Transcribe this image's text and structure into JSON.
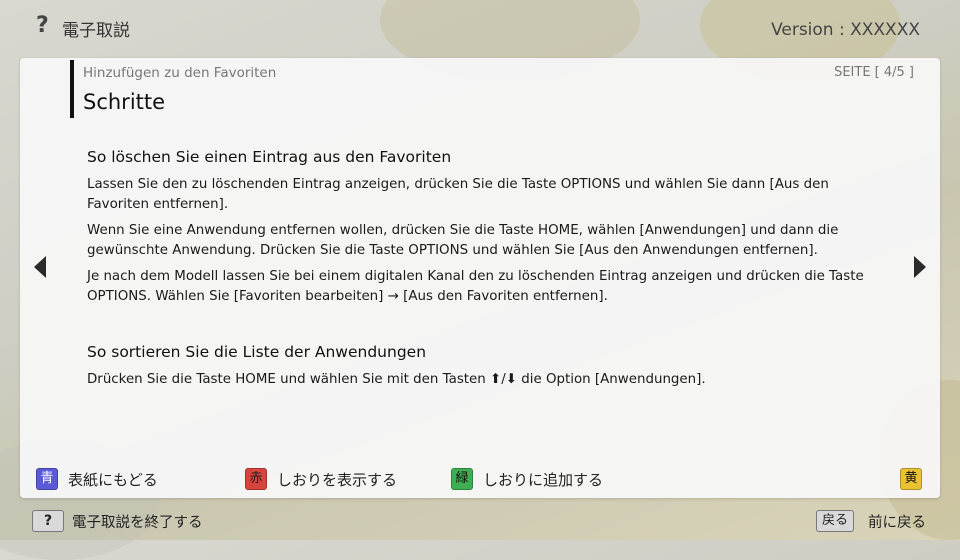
{
  "header": {
    "title": "電子取説",
    "version": "Version : XXXXXX"
  },
  "panel": {
    "breadcrumb": "Hinzufügen zu den Favoriten",
    "page_indicator": "SEITE [ 4/5 ]",
    "title": "Schritte"
  },
  "sections": [
    {
      "heading": "So löschen Sie einen Eintrag aus den Favoriten",
      "paragraphs": [
        "Lassen Sie den zu löschenden Eintrag anzeigen, drücken Sie die Taste OPTIONS und wählen Sie dann [Aus den Favoriten entfernen].",
        "Wenn Sie eine Anwendung entfernen wollen, drücken Sie die Taste HOME, wählen [Anwendungen] und dann die gewünschte Anwendung. Drücken Sie die Taste OPTIONS und wählen Sie [Aus den Anwendungen entfernen].",
        "Je nach dem Modell lassen Sie bei einem digitalen Kanal den zu löschenden Eintrag anzeigen und drücken die Taste OPTIONS. Wählen Sie [Favoriten bearbeiten] → [Aus den Favoriten entfernen]."
      ]
    },
    {
      "heading": "So sortieren Sie die Liste der Anwendungen",
      "paragraphs": [
        "Drücken Sie die Taste HOME und wählen Sie mit den Tasten ⬆/⬇ die Option [Anwendungen]."
      ]
    }
  ],
  "color_buttons": {
    "blue": {
      "badge": "青",
      "label": "表紙にもどる",
      "color": "#5a5ad6"
    },
    "red": {
      "badge": "赤",
      "label": "しおりを表示する",
      "color": "#d8443c"
    },
    "green": {
      "badge": "緑",
      "label": "しおりに追加する",
      "color": "#3fae53"
    },
    "yellow": {
      "badge": "黄",
      "label": "",
      "color": "#e8c233"
    }
  },
  "bottom": {
    "help_key": "?",
    "exit_label": "電子取説を終了する",
    "back_key": "戻る",
    "back_label": "前に戻る"
  }
}
